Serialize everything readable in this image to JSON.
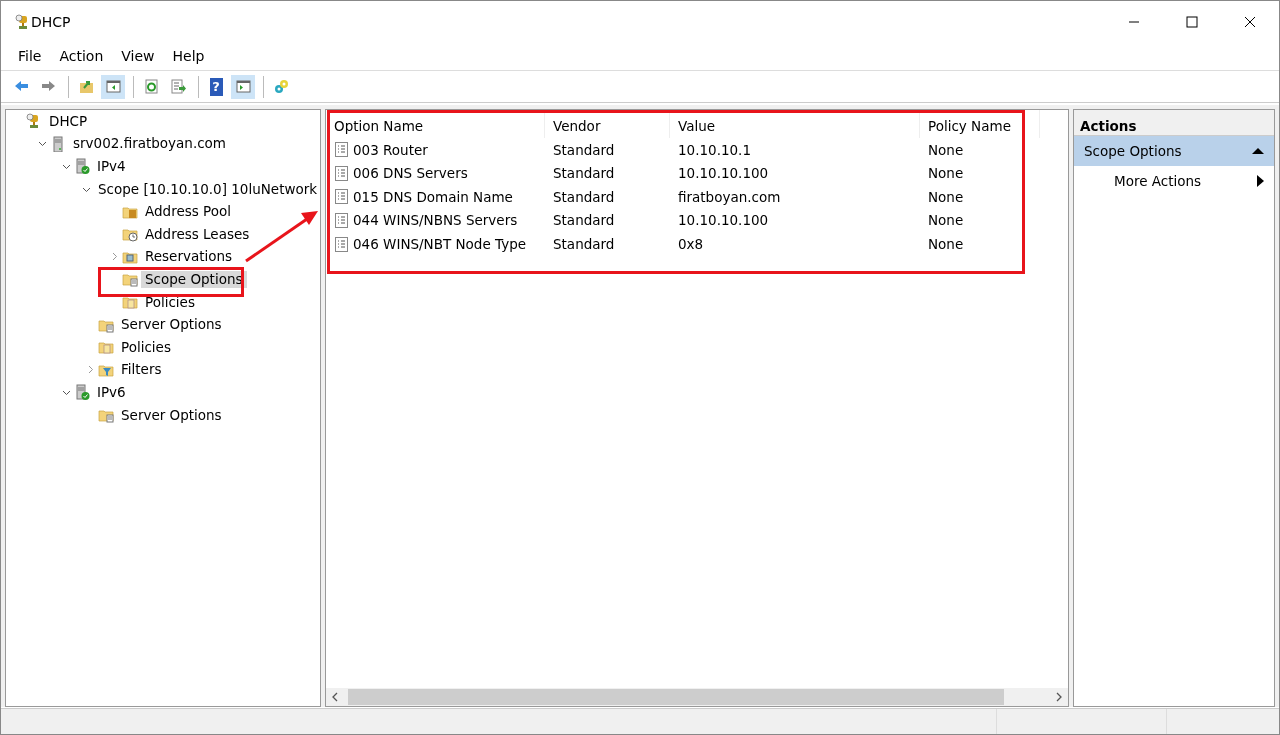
{
  "window": {
    "title": "DHCP"
  },
  "menu": [
    "File",
    "Action",
    "View",
    "Help"
  ],
  "toolbar": [
    [
      {
        "kind": "back",
        "pressed": false
      },
      {
        "kind": "forward",
        "pressed": false
      }
    ],
    [
      {
        "kind": "up",
        "pressed": false
      },
      {
        "kind": "tree",
        "pressed": true
      }
    ],
    [
      {
        "kind": "refresh",
        "pressed": false
      },
      {
        "kind": "export",
        "pressed": false
      }
    ],
    [
      {
        "kind": "help",
        "glyph": "?",
        "pressed": false
      },
      {
        "kind": "pane",
        "pressed": true
      }
    ],
    [
      {
        "kind": "gears",
        "pressed": false
      }
    ]
  ],
  "tree": [
    {
      "label": "DHCP",
      "kind": "root",
      "selected": false,
      "children": [
        {
          "label": "srv002.firatboyan.com",
          "kind": "server",
          "expanded": true,
          "selected": false,
          "children": [
            {
              "label": "IPv4",
              "kind": "ip",
              "expanded": true,
              "selected": false,
              "children": [
                {
                  "label": "Scope [10.10.10.0] 10luNetwork",
                  "kind": "folder",
                  "expanded": true,
                  "selected": false,
                  "children": [
                    {
                      "label": "Address Pool",
                      "kind": "pool",
                      "selected": false
                    },
                    {
                      "label": "Address Leases",
                      "kind": "leases",
                      "selected": false
                    },
                    {
                      "label": "Reservations",
                      "kind": "reservations",
                      "expanded": false,
                      "selected": false
                    },
                    {
                      "label": "Scope Options",
                      "kind": "options",
                      "selected": true
                    },
                    {
                      "label": "Policies",
                      "kind": "policies",
                      "selected": false
                    }
                  ]
                },
                {
                  "label": "Server Options",
                  "kind": "options",
                  "selected": false
                },
                {
                  "label": "Policies",
                  "kind": "policies",
                  "selected": false
                },
                {
                  "label": "Filters",
                  "kind": "filters",
                  "expanded": false,
                  "selected": false
                }
              ]
            },
            {
              "label": "IPv6",
              "kind": "ip",
              "expanded": true,
              "selected": false,
              "children": [
                {
                  "label": "Server Options",
                  "kind": "options",
                  "selected": false
                }
              ]
            }
          ]
        }
      ]
    }
  ],
  "table": {
    "columns": [
      "Option Name",
      "Vendor",
      "Value",
      "Policy Name"
    ],
    "rows": [
      [
        "003 Router",
        "Standard",
        "10.10.10.1",
        "None"
      ],
      [
        "006 DNS Servers",
        "Standard",
        "10.10.10.100",
        "None"
      ],
      [
        "015 DNS Domain Name",
        "Standard",
        "firatboyan.com",
        "None"
      ],
      [
        "044 WINS/NBNS Servers",
        "Standard",
        "10.10.10.100",
        "None"
      ],
      [
        "046 WINS/NBT Node Type",
        "Standard",
        "0x8",
        "None"
      ]
    ]
  },
  "actions": {
    "title": "Actions",
    "section": {
      "label": "Scope Options",
      "expanded": true
    },
    "items": [
      "More Actions"
    ]
  }
}
